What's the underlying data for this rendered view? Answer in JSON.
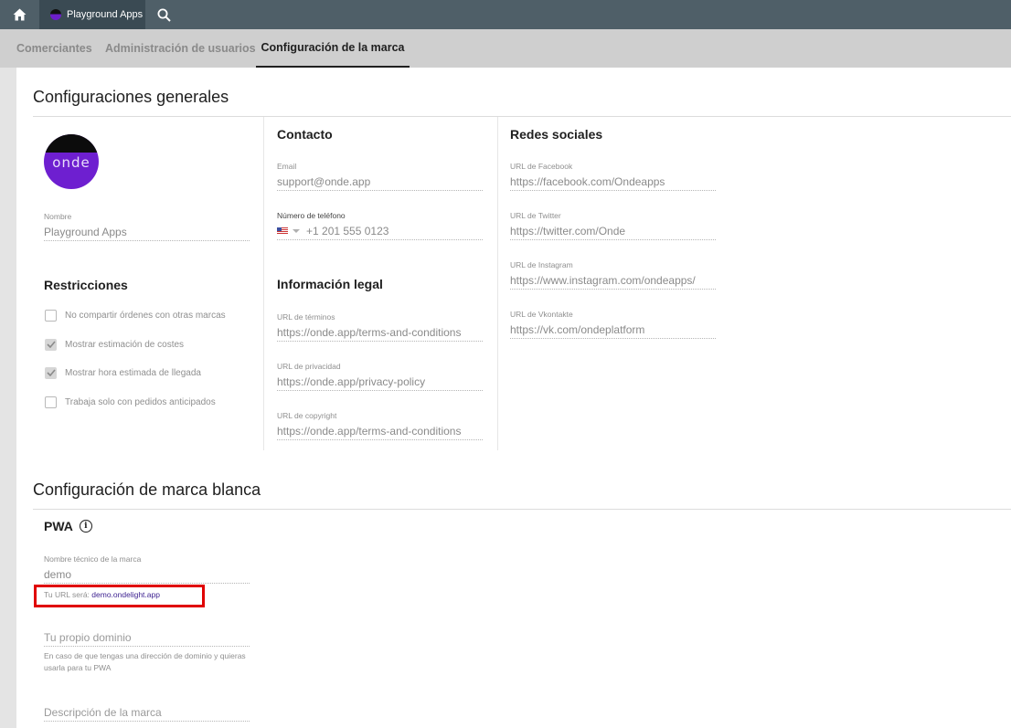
{
  "topbar": {
    "home_icon": "home-icon",
    "app_tab_label": "Playground Apps",
    "search_icon": "search-icon"
  },
  "subnav": {
    "tabs": [
      {
        "label": "Comerciantes",
        "active": false
      },
      {
        "label": "Administración de usuarios",
        "active": false
      },
      {
        "label": "Configuración de la marca",
        "active": true
      }
    ]
  },
  "general": {
    "title": "Configuraciones generales",
    "logo_text": "onde",
    "name_label": "Nombre",
    "name_value": "Playground Apps",
    "restrictions": {
      "title": "Restricciones",
      "items": [
        {
          "label": "No compartir órdenes con otras marcas",
          "checked": false
        },
        {
          "label": "Mostrar estimación de costes",
          "checked": true
        },
        {
          "label": "Mostrar hora estimada de llegada",
          "checked": true
        },
        {
          "label": "Trabaja solo con pedidos anticipados",
          "checked": false
        }
      ]
    },
    "contact": {
      "title": "Contacto",
      "email_label": "Email",
      "email_value": "support@onde.app",
      "phone_label": "Número de teléfono",
      "phone_value": "+1 201 555 0123"
    },
    "legal": {
      "title": "Información legal",
      "terms_label": "URL de términos",
      "terms_value": "https://onde.app/terms-and-conditions",
      "privacy_label": "URL de privacidad",
      "privacy_value": "https://onde.app/privacy-policy",
      "copyright_label": "URL de copyright",
      "copyright_value": "https://onde.app/terms-and-conditions"
    },
    "social": {
      "title": "Redes sociales",
      "facebook_label": "URL de Facebook",
      "facebook_value": "https://facebook.com/Ondeapps",
      "twitter_label": "URL de Twitter",
      "twitter_value": "https://twitter.com/Onde",
      "instagram_label": "URL de Instagram",
      "instagram_value": "https://www.instagram.com/ondeapps/",
      "vk_label": "URL de Vkontakte",
      "vk_value": "https://vk.com/ondeplatform"
    }
  },
  "white_label": {
    "title": "Configuración de marca blanca",
    "pwa_title": "PWA",
    "tech_name_label": "Nombre técnico de la marca",
    "tech_name_value": "demo",
    "url_hint_prefix": "Tu URL será:",
    "url_hint_link": "demo.ondelight.app",
    "domain_placeholder": "Tu propio dominio",
    "domain_help": "En caso de que tengas una dirección de dominio y quieras usarla para tu PWA",
    "description_placeholder": "Descripción de la marca"
  },
  "colors": {
    "topbar": "#4f5f68",
    "subnav": "#cfcfcf",
    "brand_purple": "#6e1fd0",
    "highlight_red": "#e00000"
  }
}
